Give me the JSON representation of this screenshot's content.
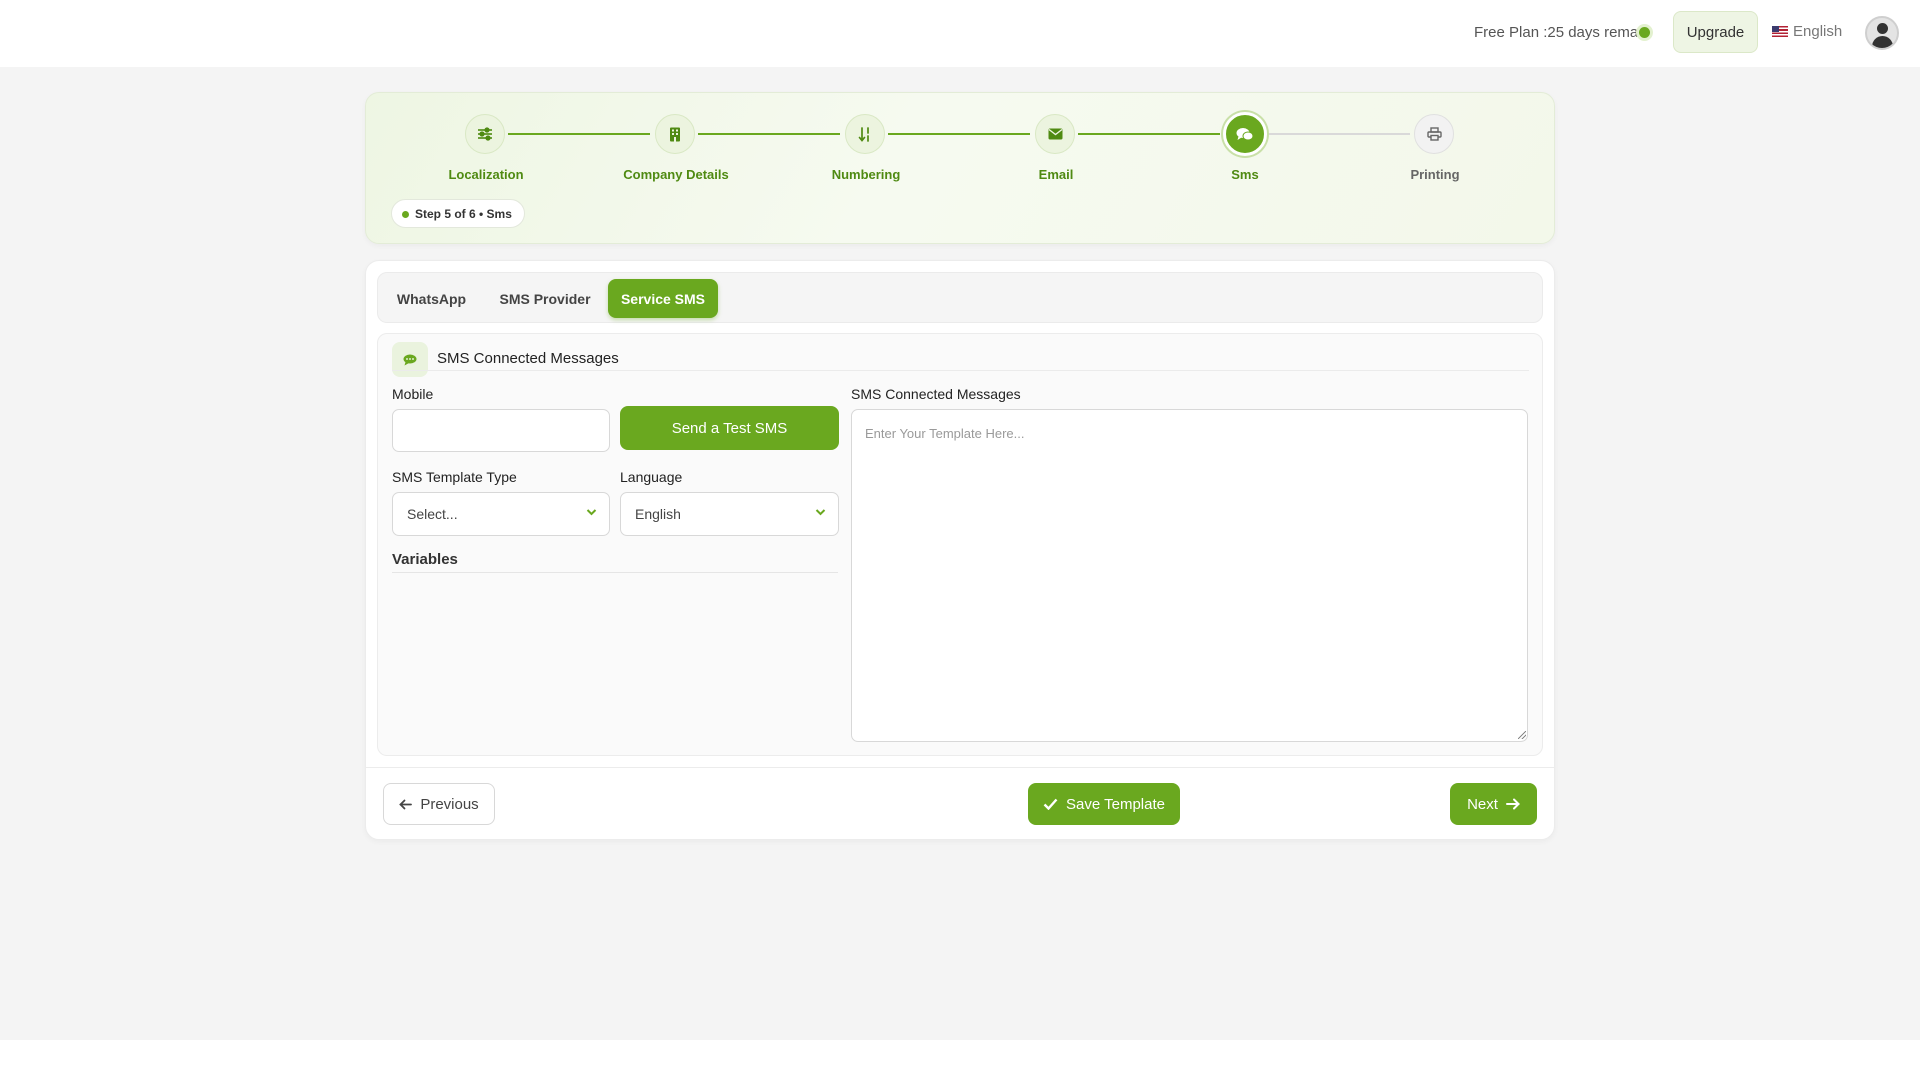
{
  "header": {
    "plan_text": "Free Plan :25 days remain",
    "upgrade_label": "Upgrade",
    "language": "English"
  },
  "stepper": {
    "steps": [
      {
        "label": "Localization",
        "icon": "sliders-icon",
        "status": "done"
      },
      {
        "label": "Company Details",
        "icon": "building-icon",
        "status": "done"
      },
      {
        "label": "Numbering",
        "icon": "sort-numbers-icon",
        "status": "done"
      },
      {
        "label": "Email",
        "icon": "envelope-icon",
        "status": "done"
      },
      {
        "label": "Sms",
        "icon": "chat-bubbles-icon",
        "status": "active"
      },
      {
        "label": "Printing",
        "icon": "printer-icon",
        "status": "todo"
      }
    ],
    "progress_text": "Step 5 of 6 •  Sms",
    "current_step": 5,
    "total_steps": 6
  },
  "tabs": [
    {
      "label": "WhatsApp",
      "active": false
    },
    {
      "label": "SMS Provider",
      "active": false
    },
    {
      "label": "Service SMS",
      "active": true
    }
  ],
  "section": {
    "title": "SMS Connected Messages",
    "icon": "chat-icon"
  },
  "form": {
    "mobile_label": "Mobile",
    "mobile_value": "",
    "send_test_label": "Send a Test SMS",
    "template_type_label": "SMS Template Type",
    "template_type_value": "Select...",
    "language_label": "Language",
    "language_value": "English",
    "variables_label": "Variables",
    "message_label": "SMS Connected Messages",
    "message_placeholder": "Enter Your Template Here..."
  },
  "footer": {
    "previous_label": "Previous",
    "save_label": "Save Template",
    "next_label": "Next"
  },
  "colors": {
    "accent": "#6aa81f",
    "accent_light": "#eaf3de",
    "step_label": "#4f8a12"
  }
}
